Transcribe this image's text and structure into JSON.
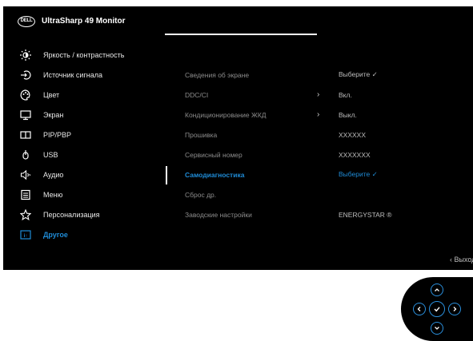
{
  "header": {
    "logo_text": "DELL",
    "title": "UltraSharp 49 Monitor"
  },
  "menu": [
    {
      "label": "Яркость / контрастность",
      "icon": "brightness-icon"
    },
    {
      "label": "Источник сигнала",
      "icon": "input-source-icon"
    },
    {
      "label": "Цвет",
      "icon": "color-palette-icon"
    },
    {
      "label": "Экран",
      "icon": "display-icon"
    },
    {
      "label": "PIP/PBP",
      "icon": "pip-pbp-icon"
    },
    {
      "label": "USB",
      "icon": "usb-icon"
    },
    {
      "label": "Аудио",
      "icon": "audio-icon"
    },
    {
      "label": "Меню",
      "icon": "menu-icon"
    },
    {
      "label": "Персонализация",
      "icon": "star-icon"
    },
    {
      "label": "Другое",
      "icon": "others-icon",
      "active": true
    }
  ],
  "submenu": [
    {
      "label": "Сведения об экране",
      "arrow": "",
      "value": "Выберите ✓"
    },
    {
      "label": "DDC/CI",
      "arrow": "›",
      "value": "Вкл."
    },
    {
      "label": "Кондиционирование ЖКД",
      "arrow": "›",
      "value": "Выкл."
    },
    {
      "label": "Прошивка",
      "arrow": "",
      "value": "XXXXXX"
    },
    {
      "label": "Сервисный номер",
      "arrow": "",
      "value": "XXXXXXX"
    },
    {
      "label": "Самодиагностика",
      "arrow": "",
      "value": "Выберите ✓",
      "active": true
    },
    {
      "label": "Сброс др.",
      "arrow": "",
      "value": ""
    },
    {
      "label": "Заводские настройки",
      "arrow": "",
      "value": "ENERGYSTAR ®"
    }
  ],
  "footer": {
    "exit_label": "‹ Выход"
  },
  "colors": {
    "accent": "#1f8bd6",
    "background": "#000000"
  }
}
